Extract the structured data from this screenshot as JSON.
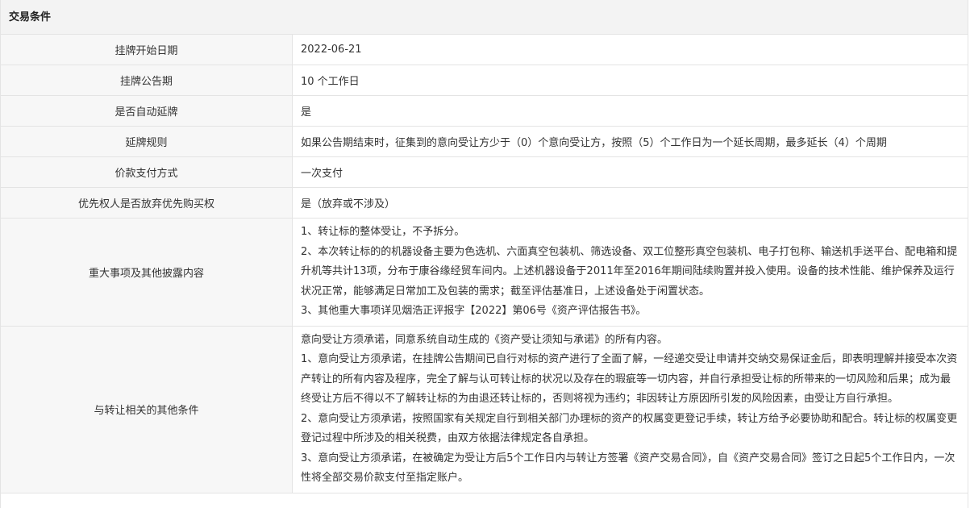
{
  "section": {
    "title": "交易条件"
  },
  "rows": [
    {
      "label": "挂牌开始日期",
      "value": "2022-06-21"
    },
    {
      "label": "挂牌公告期",
      "value": "10 个工作日"
    },
    {
      "label": "是否自动延牌",
      "value": "是"
    },
    {
      "label": "延牌规则",
      "value": "如果公告期结束时，征集到的意向受让方少于（0）个意向受让方，按照（5）个工作日为一个延长周期，最多延长（4）个周期"
    },
    {
      "label": "价款支付方式",
      "value": "一次支付"
    },
    {
      "label": "优先权人是否放弃优先购买权",
      "value": "是（放弃或不涉及）"
    },
    {
      "label": "重大事项及其他披露内容",
      "paragraphs": [
        "1、转让标的整体受让，不予拆分。",
        "2、本次转让标的的机器设备主要为色选机、六面真空包装机、筛选设备、双工位整形真空包装机、电子打包称、输送机手送平台、配电箱和提升机等共计13项，分布于康谷缘经贸车间内。上述机器设备于2011年至2016年期间陆续购置并投入使用。设备的技术性能、维护保养及运行状况正常，能够满足日常加工及包装的需求；截至评估基准日，上述设备处于闲置状态。",
        "3、其他重大事项详见烟浩正评报字【2022】第06号《资产评估报告书》。"
      ]
    },
    {
      "label": "与转让相关的其他条件",
      "paragraphs": [
        "意向受让方须承诺，同意系统自动生成的《资产受让须知与承诺》的所有内容。",
        "1、意向受让方须承诺，在挂牌公告期间已自行对标的资产进行了全面了解，一经递交受让申请并交纳交易保证金后，即表明理解并接受本次资产转让的所有内容及程序，完全了解与认可转让标的状况以及存在的瑕疵等一切内容，并自行承担受让标的所带来的一切风险和后果；成为最终受让方后不得以不了解转让标的为由退还转让标的，否则将视为违约；非因转让方原因所引发的风险因素，由受让方自行承担。",
        "2、意向受让方须承诺，按照国家有关规定自行到相关部门办理标的资产的权属变更登记手续，转让方给予必要协助和配合。转让标的权属变更登记过程中所涉及的相关税费，由双方依据法律规定各自承担。",
        "3、意向受让方须承诺，在被确定为受让方后5个工作日内与转让方签署《资产交易合同》，自《资产交易合同》签订之日起5个工作日内，一次性将全部交易价款支付至指定账户。"
      ]
    }
  ]
}
